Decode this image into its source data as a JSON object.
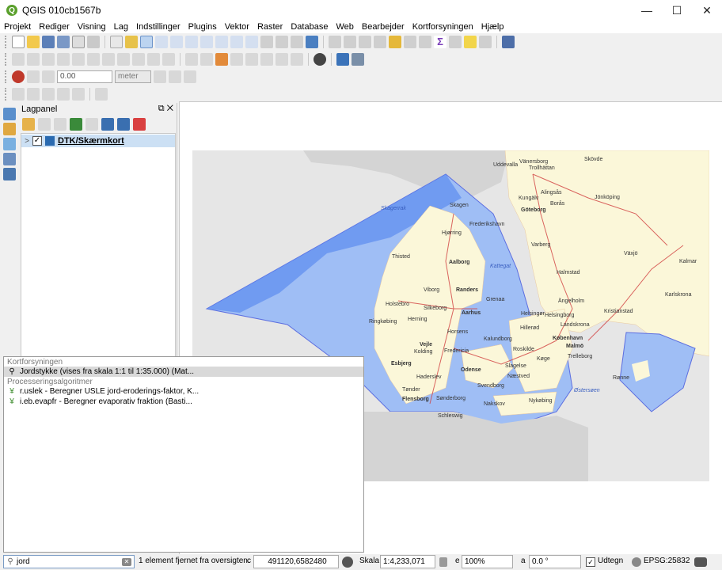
{
  "window": {
    "title": "QGIS 010cb1567b",
    "minimize": "—",
    "maximize": "☐",
    "close": "✕"
  },
  "menu": [
    "Projekt",
    "Rediger",
    "Visning",
    "Lag",
    "Indstillinger",
    "Plugins",
    "Vektor",
    "Raster",
    "Database",
    "Web",
    "Bearbejder",
    "Kortforsyningen",
    "Hjælp"
  ],
  "snapping": {
    "tolerance": "0.00",
    "unit": "meter"
  },
  "layers_panel": {
    "title": "Lagpanel",
    "layers": [
      {
        "name": "DTK/Skærmkort",
        "checked": true,
        "expander": ">"
      }
    ]
  },
  "map": {
    "labels": {
      "skagerrak": "Skagerrak",
      "kattegat": "Kattegat",
      "ostersoen": "Østersøen",
      "skagen": "Skagen",
      "frederikshavn": "Frederikshavn",
      "hjorring": "Hjørring",
      "thisted": "Thisted",
      "aalborg": "Aalborg",
      "viborg": "Viborg",
      "randers": "Randers",
      "grenaa": "Grenaa",
      "holstebro": "Holstebro",
      "silkeborg": "Silkeborg",
      "aarhus": "Aarhus",
      "ringkobing": "Ringkøbing",
      "herning": "Herning",
      "horsens": "Horsens",
      "vejle": "Vejle",
      "kolding": "Kolding",
      "fredericia": "Fredericia",
      "esbjerg": "Esbjerg",
      "haderslev": "Haderslev",
      "odense": "Odense",
      "svendborg": "Svendborg",
      "tonder": "Tønder",
      "flensborg": "Flensborg",
      "sonderborg": "Sønderborg",
      "schleswig": "Schleswig",
      "nakskov": "Nakskov",
      "nykobing": "Nykøbing",
      "naestved": "Næstved",
      "slagelse": "Slagelse",
      "kalundborg": "Kalundborg",
      "roskilde": "Roskilde",
      "koge": "Køge",
      "hillerod": "Hillerød",
      "helsingor": "Helsingør",
      "kobenhavn": "København",
      "malmo": "Malmö",
      "trelleborg": "Trelleborg",
      "landskrona": "Landskrona",
      "helsingborg": "Helsingborg",
      "angelholm": "Ängelholm",
      "kristianstad": "Kristianstad",
      "halmstad": "Halmstad",
      "goteborg": "Göteborg",
      "varberg": "Varberg",
      "boras": "Borås",
      "kungalv": "Kungälv",
      "alingsas": "Alingsås",
      "uddevalla": "Uddevalla",
      "vanersborg": "Vänersborg",
      "trollhattan": "Trollhättan",
      "skovde": "Skövde",
      "jonkoping": "Jönköping",
      "vaxjo": "Växjö",
      "kalmar": "Kalmar",
      "karlskrona": "Karlskrona",
      "ronne": "Rønne"
    }
  },
  "locator": {
    "groups": [
      {
        "title": "Kortforsyningen",
        "items": [
          {
            "icon": "search-icon",
            "text": "Jordstykke (vises fra skala 1:1 til 1:35.000) (Mat...",
            "selected": true
          }
        ]
      },
      {
        "title": "Processeringsalgoritmer",
        "items": [
          {
            "icon": "grass-icon",
            "text": "r.uslek - Beregner USLE jord-eroderings-faktor, K...",
            "selected": false
          },
          {
            "icon": "grass-icon",
            "text": "i.eb.evapfr - Beregner evaporativ fraktion (Basti...",
            "selected": false
          }
        ]
      }
    ]
  },
  "statusbar": {
    "search_value": "jord",
    "message": "1 element fjernet fra oversigten.",
    "coord_prefix": "c",
    "coordinate": "491120,6582480",
    "scale_label": "Skala",
    "scale_value": "1:4,233,071",
    "magnifier_prefix": "e",
    "magnifier_value": "100%",
    "rotation_prefix": "a",
    "rotation_value": "0.0 °",
    "render_label": "Udtegn",
    "render_checked": true,
    "crs": "EPSG:25832"
  },
  "colors": {
    "sea": "#9fbef5",
    "deep_sea": "#5c8bf0",
    "land": "#fbf7d9",
    "outside": "#e6e6e6",
    "select": "#cce0f4"
  }
}
